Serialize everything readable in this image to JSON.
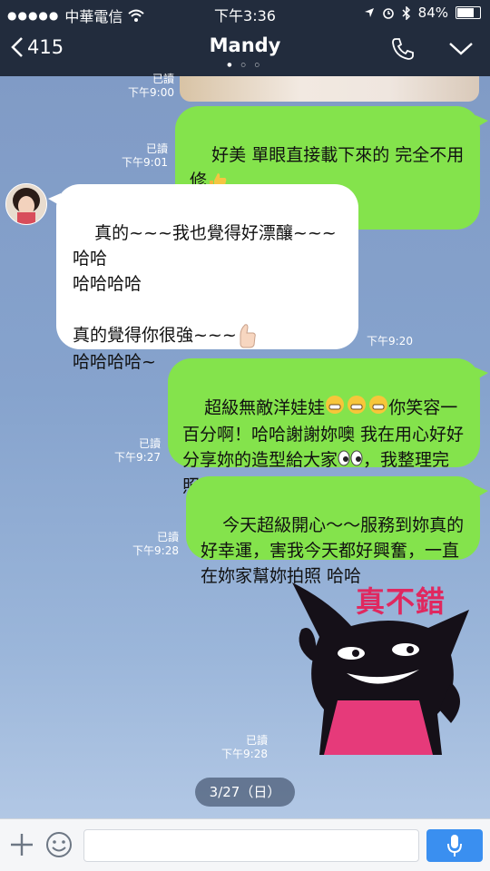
{
  "status_bar": {
    "signal": "●●●●●",
    "carrier": "中華電信",
    "time": "下午3:36",
    "battery": "84%",
    "battery_level": 0.84
  },
  "nav": {
    "back_count": "415",
    "title": "Mandy"
  },
  "messages": [
    {
      "dir": "out",
      "read": "已讀",
      "time": "下午9:00"
    },
    {
      "dir": "out",
      "text": "好美 單眼直接載下來的 完全不用修",
      "emoji": "thumbs-up",
      "read": "已讀",
      "time": "下午9:01"
    },
    {
      "dir": "in",
      "text1": "真的~~~我也覺得好漂釀~~~哈哈\n哈哈哈哈\n\n真的覺得你很強~~~",
      "text2": "\n哈哈哈哈~",
      "emoji": "thumbs-up",
      "time": "下午9:20"
    },
    {
      "dir": "out",
      "text_a": "超級無敵洋娃娃",
      "text_b": "你笑容一百分啊！哈哈謝謝妳噢 我在用心好好分享妳的造型給大家",
      "text_c": "，我整理完照片會送給你der~~",
      "read": "已讀",
      "time": "下午9:27"
    },
    {
      "dir": "out",
      "text": "今天超級開心～～服務到妳真的好幸運，害我今天都好興奮，一直在妳家幫妳拍照 哈哈",
      "read": "已讀",
      "time": "下午9:28"
    },
    {
      "dir": "out",
      "type": "sticker",
      "sticker_text": "真不錯",
      "read": "已讀",
      "time": "下午9:28"
    }
  ],
  "date_separator": "3/27（日）",
  "input": {
    "placeholder": ""
  },
  "colors": {
    "outgoing": "#84e34c",
    "incoming": "#ffffff",
    "header": "#222c3d",
    "mic": "#3a8ff0"
  }
}
